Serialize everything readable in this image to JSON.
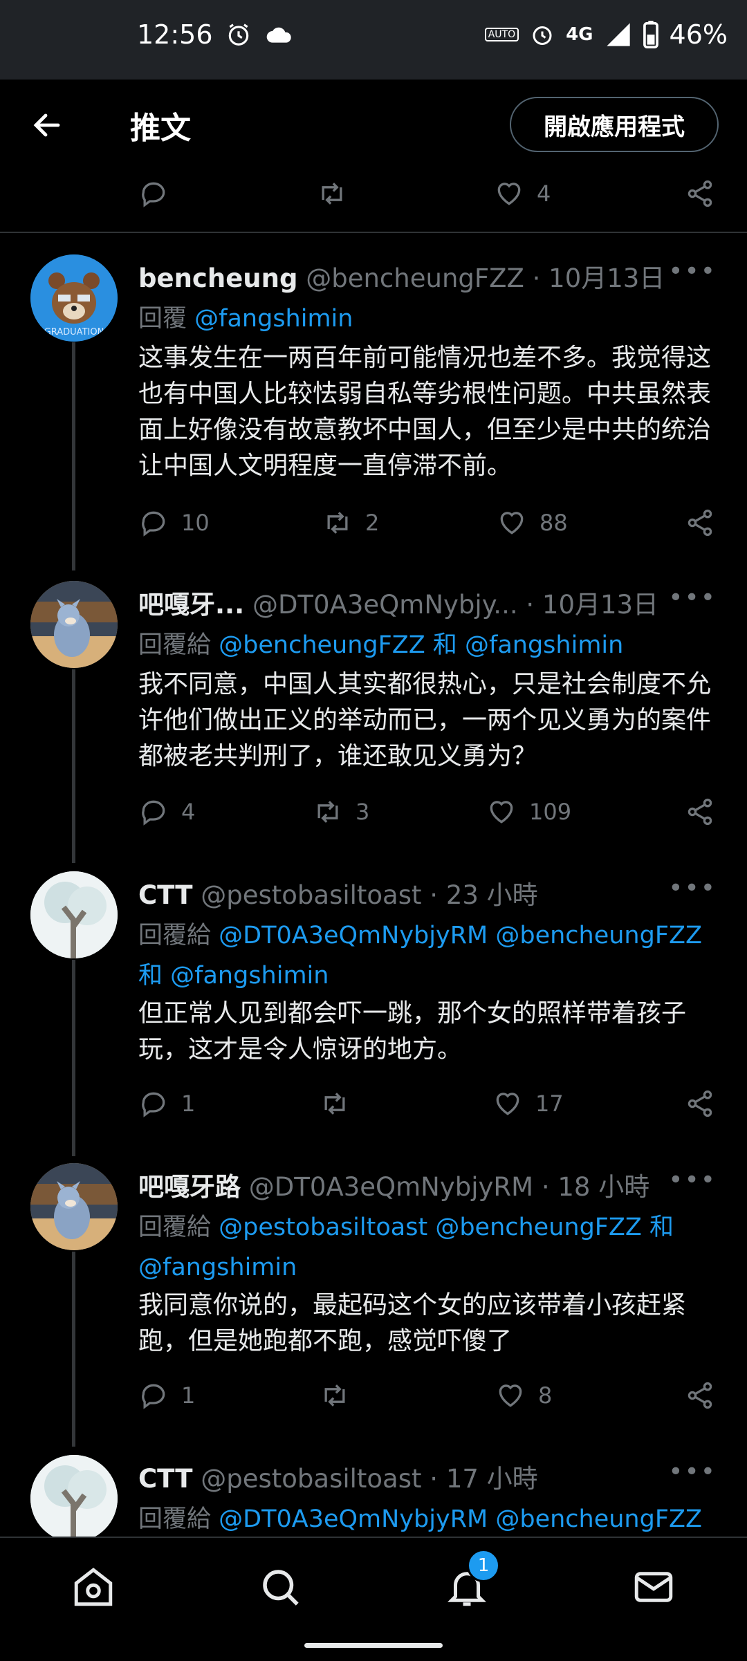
{
  "status_bar": {
    "time": "12:56",
    "chip": "AUTO",
    "network": "4G",
    "battery": "46%"
  },
  "header": {
    "title": "推文",
    "open_app_button": "開啟應用程式"
  },
  "top_actions": {
    "likes": "4"
  },
  "tweets": [
    {
      "name": "bencheung",
      "handle": "@bencheungFZZ",
      "date": "· 10月13日",
      "reply_prefix": "回覆",
      "mentions": [
        "@fangshimin"
      ],
      "body": "这事发生在一两百年前可能情况也差不多。我觉得这也有中国人比较怯弱自私等劣根性问题。中共虽然表面上好像没有故意教坏中国人，但至少是中共的统治让中国人文明程度一直停滞不前。",
      "replies": "10",
      "retweets": "2",
      "likes": "88",
      "avatar_text": "GRADUATION"
    },
    {
      "name": "吧嘎牙...",
      "handle": "@DT0A3eQmNybjy...",
      "date": "· 10月13日",
      "reply_prefix": "回覆給",
      "mentions": [
        "@bencheungFZZ",
        "和",
        "@fangshimin"
      ],
      "body": "我不同意，中国人其实都很热心，只是社会制度不允许他们做出正义的举动而已，一两个见义勇为的案件都被老共判刑了，谁还敢见义勇为？",
      "replies": "4",
      "retweets": "3",
      "likes": "109"
    },
    {
      "name": "CTT",
      "handle": "@pestobasiltoast",
      "date": "· 23 小時",
      "reply_prefix": "回覆給",
      "mentions": [
        "@DT0A3eQmNybjyRM",
        "@bencheungFZZ",
        "和",
        "@fangshimin"
      ],
      "body": "但正常人见到都会吓一跳，那个女的照样带着孩子玩，这才是令人惊讶的地方。",
      "replies": "1",
      "retweets": "",
      "likes": "17"
    },
    {
      "name": "吧嘎牙路",
      "handle": "@DT0A3eQmNybjyRM",
      "date": "· 18 小時",
      "reply_prefix": "回覆給",
      "mentions": [
        "@pestobasiltoast",
        "@bencheungFZZ",
        "和",
        "@fangshimin"
      ],
      "body": "我同意你说的，最起码这个女的应该带着小孩赶紧跑，但是她跑都不跑，感觉吓傻了",
      "replies": "1",
      "retweets": "",
      "likes": "8"
    },
    {
      "name": "CTT",
      "handle": "@pestobasiltoast",
      "date": "· 17 小時",
      "reply_prefix": "回覆給",
      "mentions": [
        "@DT0A3eQmNybjyRM",
        "@bencheungFZZ"
      ],
      "body": "",
      "replies": "",
      "retweets": "",
      "likes": ""
    }
  ],
  "more_label": "•••",
  "bottom_nav": {
    "notification_count": "1"
  },
  "colors": {
    "accent": "#1d9bf0",
    "muted": "#71767b",
    "background": "#000000"
  }
}
